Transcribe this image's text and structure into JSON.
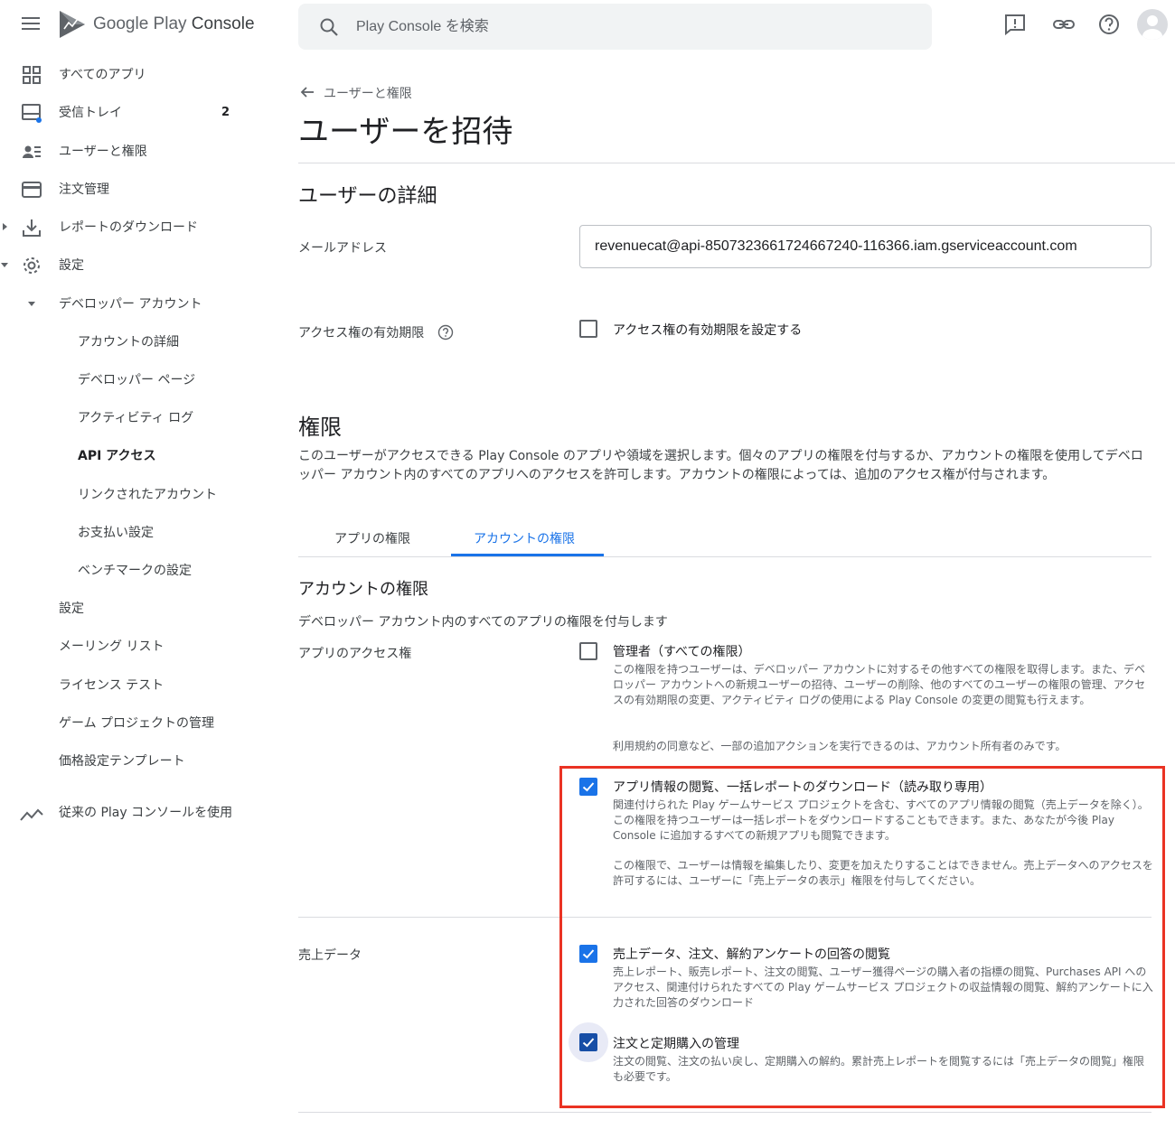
{
  "header": {
    "brand_google": "Google Play",
    "brand_console": "Console",
    "search_placeholder": "Play Console を検索"
  },
  "sidebar": {
    "items": [
      {
        "label": "すべてのアプリ",
        "icon": "grid-icon"
      },
      {
        "label": "受信トレイ",
        "icon": "inbox-icon",
        "badge": "2"
      },
      {
        "label": "ユーザーと権限",
        "icon": "users-icon"
      },
      {
        "label": "注文管理",
        "icon": "credit-card-icon"
      },
      {
        "label": "レポートのダウンロード",
        "icon": "download-icon"
      },
      {
        "label": "設定",
        "icon": "gear-icon"
      },
      {
        "label": "デベロッパー アカウント"
      },
      {
        "label": "アカウントの詳細"
      },
      {
        "label": "デベロッパー ページ"
      },
      {
        "label": "アクティビティ ログ"
      },
      {
        "label": "API アクセス"
      },
      {
        "label": "リンクされたアカウント"
      },
      {
        "label": "お支払い設定"
      },
      {
        "label": "ベンチマークの設定"
      },
      {
        "label": "設定"
      },
      {
        "label": "メーリング リスト"
      },
      {
        "label": "ライセンス テスト"
      },
      {
        "label": "ゲーム プロジェクトの管理"
      },
      {
        "label": "価格設定テンプレート"
      }
    ],
    "legacy_label": "従来の Play コンソールを使用"
  },
  "main": {
    "breadcrumb": "ユーザーと権限",
    "title": "ユーザーを招待",
    "user_details": {
      "heading": "ユーザーの詳細",
      "email_label": "メールアドレス",
      "email_value": "revenuecat@api-8507323661724667240-116366.iam.gserviceaccount.com",
      "expiry_label": "アクセス権の有効期限",
      "expiry_checkbox_label": "アクセス権の有効期限を設定する"
    },
    "permissions": {
      "heading": "権限",
      "intro": "このユーザーがアクセスできる Play Console のアプリや領域を選択します。個々のアプリの権限を付与するか、アカウントの権限を使用してデベロッパー アカウント内のすべてのアプリへのアクセスを許可します。アカウントの権限によっては、追加のアクセス権が付与されます。",
      "tabs": [
        {
          "label": "アプリの権限",
          "active": false
        },
        {
          "label": "アカウントの権限",
          "active": true
        }
      ],
      "account_heading": "アカウントの権限",
      "account_desc": "デベロッパー アカウント内のすべてのアプリの権限を付与します",
      "app_access_label": "アプリのアクセス権",
      "admin": {
        "label": "管理者（すべての権限）",
        "checked": false,
        "desc1": "この権限を持つユーザーは、デベロッパー アカウントに対するその他すべての権限を取得します。また、デベロッパー アカウントへの新規ユーザーの招待、ユーザーの削除、他のすべてのユーザーの権限の管理、アクセスの有効期限の変更、アクティビティ ログの使用による Play Console の変更の閲覧も行えます。",
        "desc2": "利用規約の同意など、一部の追加アクションを実行できるのは、アカウント所有者のみです。"
      },
      "view_app_info": {
        "label": "アプリ情報の閲覧、一括レポートのダウンロード（読み取り専用）",
        "checked": true,
        "desc1": "関連付けられた Play ゲームサービス プロジェクトを含む、すべてのアプリ情報の閲覧（売上データを除く）。この権限を持つユーザーは一括レポートをダウンロードすることもできます。また、あなたが今後 Play Console に追加するすべての新規アプリも閲覧できます。",
        "desc2": "この権限で、ユーザーは情報を編集したり、変更を加えたりすることはできません。売上データへのアクセスを許可するには、ユーザーに「売上データの表示」権限を付与してください。"
      },
      "financial_label": "売上データ",
      "view_financial": {
        "label": "売上データ、注文、解約アンケートの回答の閲覧",
        "checked": true,
        "desc": "売上レポート、販売レポート、注文の閲覧、ユーザー獲得ページの購入者の指標の閲覧、Purchases API へのアクセス、関連付けられたすべての Play ゲームサービス プロジェクトの収益情報の閲覧、解約アンケートに入力された回答のダウンロード"
      },
      "manage_orders": {
        "label": "注文と定期購入の管理",
        "checked": true,
        "desc": "注文の閲覧、注文の払い戻し、定期購入の解約。累計売上レポートを閲覧するには「売上データの閲覧」権限も必要です。"
      }
    }
  },
  "colors": {
    "accent": "#1a73e8",
    "highlight": "#ea3323"
  }
}
